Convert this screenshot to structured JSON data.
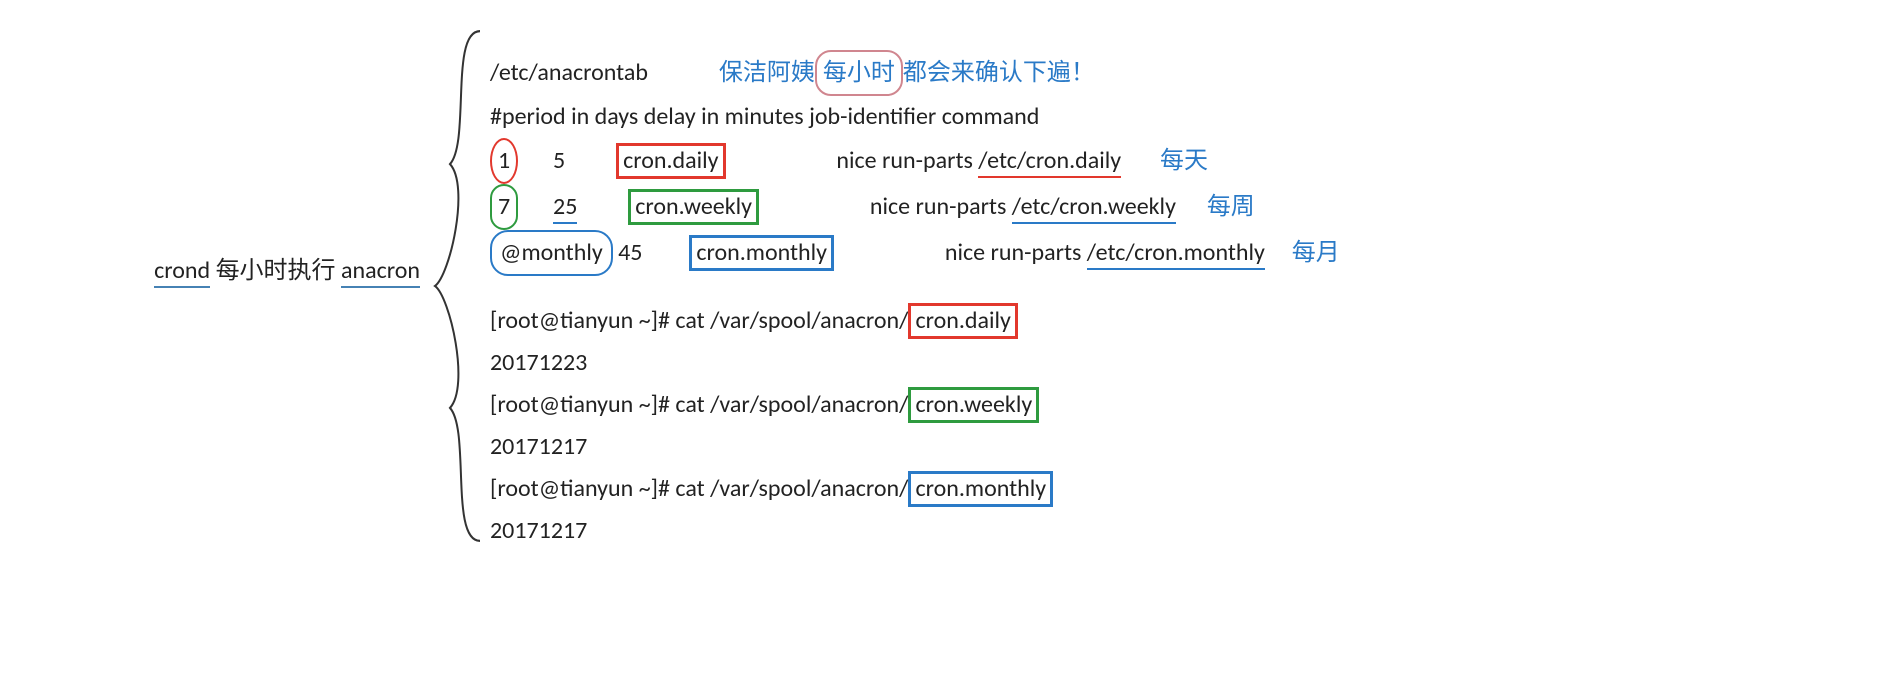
{
  "left": {
    "t1": "crond",
    "t2": "每小时执行",
    "t3": "anacron"
  },
  "hdr": {
    "path": "/etc/anacrontab",
    "note_a": "保洁阿姨",
    "note_b": "每小时",
    "note_c": "都会来确认下遍！",
    "comment": "#period in days   delay in minutes   job-identifier   command"
  },
  "rows": [
    {
      "p": "1",
      "d": "5",
      "id": "cron.daily",
      "cmd_a": "nice run-parts ",
      "cmd_b": "/etc/cron.daily",
      "lbl": "每天"
    },
    {
      "p": "7",
      "d": "25",
      "id": "cron.weekly",
      "cmd_a": "nice run-parts ",
      "cmd_b": "/etc/cron.weekly",
      "lbl": "每周"
    },
    {
      "p": "@monthly",
      "d": "45",
      "id": "cron.monthly",
      "cmd_a": "nice run-parts ",
      "cmd_b": "/etc/cron.monthly",
      "lbl": "每月"
    }
  ],
  "term": {
    "prompt": "[root@tianyun ~]# ",
    "cmd": "cat /var/spool/anacron/",
    "e": [
      {
        "f": "cron.daily",
        "out": "20171223"
      },
      {
        "f": "cron.weekly",
        "out": "20171217"
      },
      {
        "f": "cron.monthly",
        "out": "20171217"
      }
    ]
  }
}
